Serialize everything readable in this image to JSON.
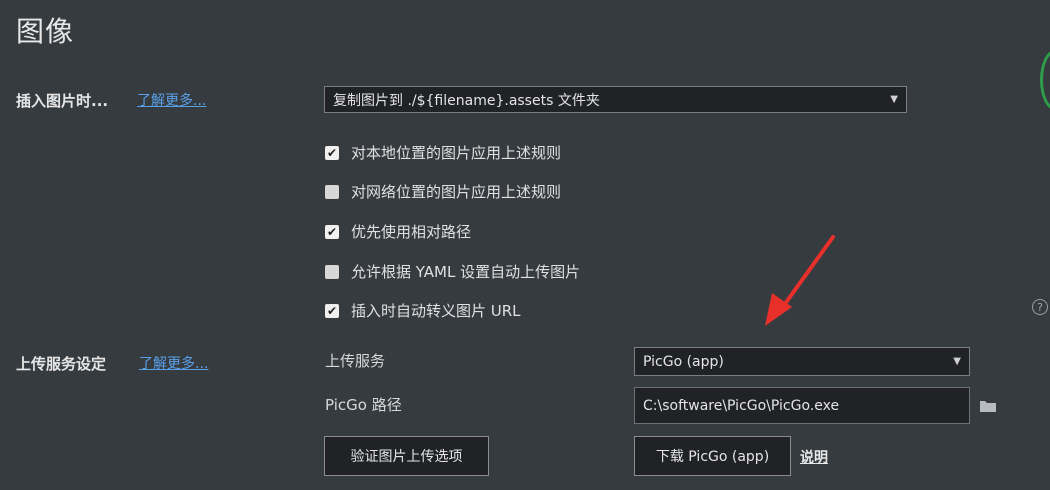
{
  "page": {
    "title": "图像"
  },
  "insert_image": {
    "label": "插入图片时...",
    "learn_more": "了解更多...",
    "select_value": "复制图片到 ./${filename}.assets 文件夹",
    "options": [
      {
        "label": "对本地位置的图片应用上述规则",
        "checked": true
      },
      {
        "label": "对网络位置的图片应用上述规则",
        "checked": false
      },
      {
        "label": "优先使用相对路径",
        "checked": true
      },
      {
        "label": "允许根据 YAML 设置自动上传图片",
        "checked": false
      },
      {
        "label": "插入时自动转义图片 URL",
        "checked": true
      }
    ]
  },
  "upload_service": {
    "label": "上传服务设定",
    "learn_more": "了解更多...",
    "service_label": "上传服务",
    "service_value": "PicGo (app)",
    "path_label": "PicGo 路径",
    "path_value": "C:\\software\\PicGo\\PicGo.exe",
    "verify_button": "验证图片上传选项",
    "download_button": "下载 PicGo (app)",
    "help_link": "说明"
  },
  "icons": {
    "checkmark": "✔",
    "dropdown": "▼",
    "help": "?",
    "folder": "folder-icon"
  },
  "colors": {
    "background": "#363b40",
    "link": "#5aa0e8",
    "annotation_arrow": "#e8302a"
  }
}
